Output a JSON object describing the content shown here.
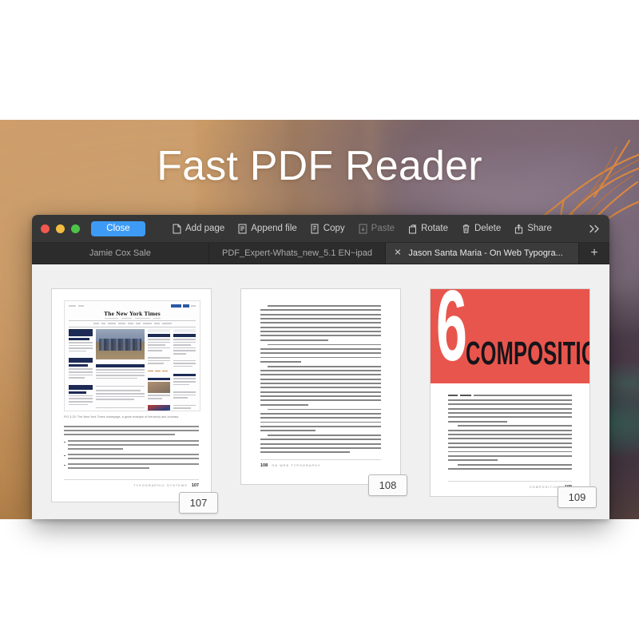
{
  "hero": {
    "title": "Fast PDF Reader"
  },
  "window": {
    "traffic_lights": [
      {
        "name": "close",
        "color": "#f1584f"
      },
      {
        "name": "minimize",
        "color": "#f3bd41"
      },
      {
        "name": "zoom",
        "color": "#4ec34a"
      }
    ],
    "toolbar": {
      "close_label": "Close",
      "close_accent": "#3e9bf5",
      "items": [
        {
          "label": "Add page",
          "icon": "page-plus-icon",
          "disabled": false
        },
        {
          "label": "Append file",
          "icon": "document-append-icon",
          "disabled": false
        },
        {
          "label": "Copy",
          "icon": "copy-icon",
          "disabled": false
        },
        {
          "label": "Paste",
          "icon": "paste-icon",
          "disabled": true
        },
        {
          "label": "Rotate",
          "icon": "rotate-icon",
          "disabled": false
        },
        {
          "label": "Delete",
          "icon": "trash-icon",
          "disabled": false
        },
        {
          "label": "Share",
          "icon": "share-icon",
          "disabled": false
        }
      ],
      "overflow_label": "»"
    },
    "tabs": [
      {
        "label": "Jamie Cox Sale",
        "active": false,
        "closable": false
      },
      {
        "label": "PDF_Expert-Whats_new_5.1 EN~ipad",
        "active": false,
        "closable": false
      },
      {
        "label": "Jason Santa Maria - On Web Typogra...",
        "active": true,
        "closable": true,
        "close_glyph": "✕"
      }
    ],
    "new_tab_label": "+"
  },
  "canvas": {
    "background": "#f0f0f0",
    "pages": [
      {
        "number": "107",
        "kind": "figure-and-text",
        "figure_caption": "FIG 5.20: The New York Times homepage, a great example of hierarchy and contrast.",
        "masthead": "The New York Times",
        "running_head_label": "TYPOGRAPHIC SYSTEMS",
        "running_head_number": "107",
        "running_head_align": "right",
        "body_text": "the middle, and some smaller articles listed on the top right. Using what we learned in the last chapter, you can pick up on the ways the site distinguishes various elements:",
        "bullets": [
          "On the top left, the large headline—set in italics for further distinction—quickly grabs a reader’s attention and provides an entry point.",
          "Because of contrast, it’s even more likely that a reader’s eye is drawn to the middle image; its size and placement set it apart.",
          "Other text may be big, too, like secondary headlines, but that contrast, here image is the page’s focal point."
        ]
      },
      {
        "number": "108",
        "kind": "text-only",
        "running_head_label": "ON WEB TYPOGRAPHY",
        "running_head_number": "108",
        "running_head_align": "left",
        "paragraphs": [
          "So, if mammoth type or images are surefire ways to pull in a reader, why don’t we stuff our pages with them? If you think about it, that type and image are so alluring because they’re unique. If we bombarded the page with more images and an array of big headlines, each would bear the same weight and cancel out any contrast. Without contrast, we don’t have hierarchy, and without hierarchy, the typography feels indistinguishable and our readers are left without a map.",
          "On the New York Times site, contrasts in type size, style, and placement apply structure to its content and set up relationships. When we first glance at something, we tend to seek patterns; we mentally group similar elements and try to uncover a pecking order.",
          "Titles on the New York Times homepage are set large, with key headlines closer to the top. Subheadings and bylines tie into the headline at smaller sizes but remain visually distinct from paragraphs. This styling underscores that the subheading is part of the same system as the headline, while establishing that the subheading is hierarchically less important. The paragraph excerpts tap into this same hierarchical system, while their type size is even smaller than that of the subheading, the paragraphs are set and styled the same as one another. This consistency means readers quickly understand that these chunks are similar kinds of content.",
          "I’ve noted simple arrangements here, but, together, they form the backbone of a strong typographic system built on relationships. All of typography is based upon a reflexive relationship: the small things inform the big things, and the big things inform the small things. The sum of this give and take means the difference between beautiful and forgettable.",
          "We’ve covered the most important typographic considerations you can make at the micro level. But what about the other end of the spectrum: the page? How do larger elements, like the browser window or grid systems, affect our lovingly crafted paragraphs and headlines? Let’s look at the big picture."
        ]
      },
      {
        "number": "109",
        "kind": "chapter-opener",
        "chapter_number": "6",
        "chapter_title": "COMPOSITION",
        "accent_color": "#e8554c",
        "running_head_label": "COMPOSITION",
        "running_head_number": "109",
        "running_head_align": "right",
        "lead_smallcaps": "TYPE HELPS",
        "paragraphs": [
          "TYPE HELPS form the message our designs seek to impart, but it resides in a larger environment made up of a page, a browser, and a device. From the outside looking in, we understand that our text, our fonts, and our beautiful typography do not exist in a vacuum. The shape of our design and the web’s fluctuating nature directly influence our typographic choices and everything we hope we convey.",
          "Depending on the problems we’re trying to solve, our approach can take different forms. Sometimes our process follows a straightforward and ordered path, especially given the number of fixed constraints a project may impose, like ad sizes or required artwork and assets. Other times, our process is more malleable, like working with clay. A sculptor may sit down to sculpt something without a clear idea of the exact form it will take; sometimes we need to start pushing and pulling on the clay to see what comes out of it.",
          "I often work in what I consider rough typographic explorations, even if they’re in a high-fidelity environment like"
        ]
      }
    ]
  }
}
